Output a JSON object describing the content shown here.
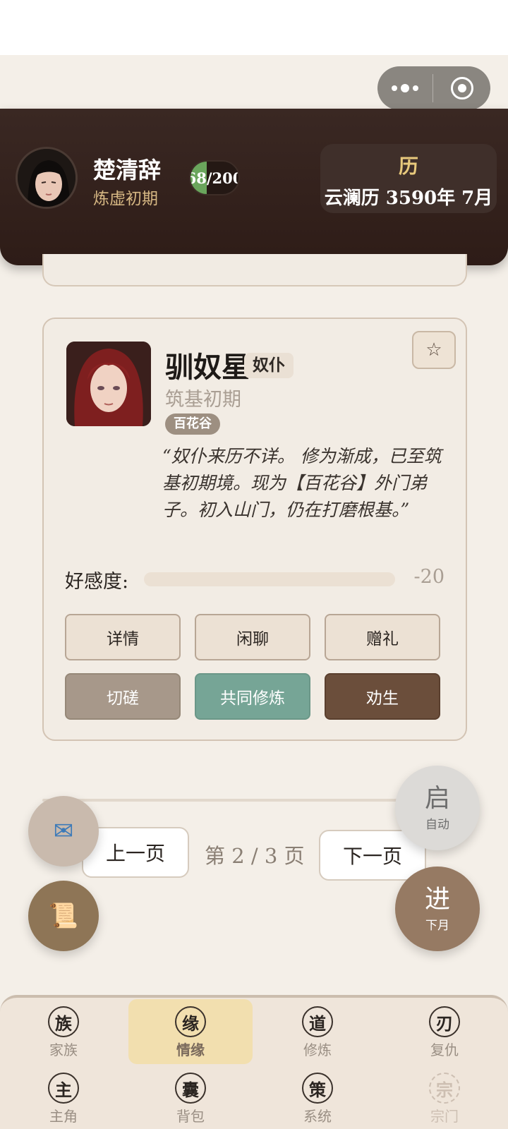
{
  "hero": {
    "name": "楚清辞",
    "realm": "炼虚初期",
    "hp_text": "68/200",
    "hp_fraction": 0.34
  },
  "calendar": {
    "icon_label": "历",
    "date": "云澜历 3590年 7月"
  },
  "npc": {
    "name": "驯奴星",
    "tag": "奴仆",
    "realm": "筑基初期",
    "sect": "百花谷",
    "favorite_icon": "☆",
    "quote": "“奴仆来历不详。 修为渐成，已至筑基初期境。现为【百花谷】外门弟子。初入山门，仍在打磨根基。”",
    "affection_label": "好感度:",
    "affection_value": "-20",
    "affection_fraction": 0.0,
    "actions": {
      "details": "详情",
      "chat": "闲聊",
      "gift": "赠礼",
      "spar": "切磋",
      "cultivate": "共同修炼",
      "persuade": "劝生"
    }
  },
  "pager": {
    "prev": "上一页",
    "info": "第 2 / 3 页",
    "next": "下一页"
  },
  "fabs": {
    "mail_icon": "✉",
    "scroll_icon": "📜",
    "auto_big": "启",
    "auto_small": "自动",
    "next_big": "进",
    "next_small": "下月"
  },
  "tabs": [
    {
      "glyph": "族",
      "label": "家族"
    },
    {
      "glyph": "缘",
      "label": "情缘"
    },
    {
      "glyph": "道",
      "label": "修炼"
    },
    {
      "glyph": "刃",
      "label": "复仇"
    },
    {
      "glyph": "主",
      "label": "主角"
    },
    {
      "glyph": "囊",
      "label": "背包"
    },
    {
      "glyph": "策",
      "label": "系统"
    },
    {
      "glyph": "宗",
      "label": "宗门"
    }
  ],
  "colors": {
    "header_bg": "#2e1c17",
    "accent_gold": "#e8c97c",
    "green_btn": "#76a596",
    "brown_btn": "#6b4e3b",
    "active_tab": "#f2dfaf"
  }
}
